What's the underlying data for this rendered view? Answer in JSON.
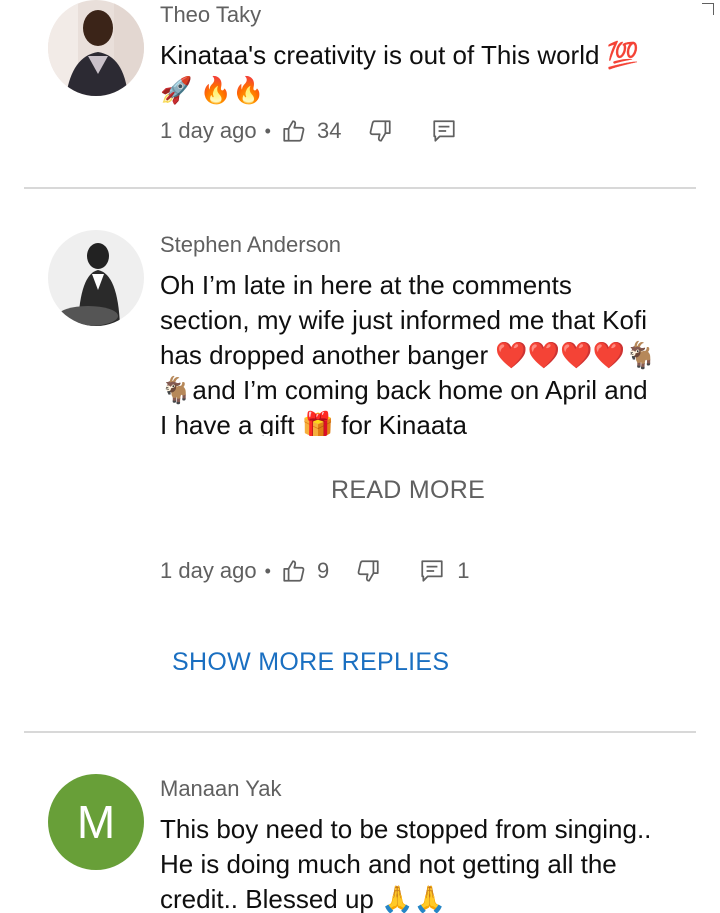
{
  "comments": [
    {
      "author": "Theo Taky",
      "text": "Kinataa's creativity is out of This world 💯🚀 🔥🔥",
      "time": "1 day ago",
      "likes": "34",
      "replies": ""
    },
    {
      "author": "Stephen Anderson",
      "text": "Oh I’m late in here at the comments section, my wife just informed me that Kofi has dropped another banger ❤️❤️❤️❤️🐐🐐and I’m coming back home on April and I have a gift 🎁 for Kinaata",
      "time": "1 day ago",
      "likes": "9",
      "replies": "1",
      "read_more_label": "READ MORE",
      "show_more_replies_label": "SHOW MORE REPLIES"
    },
    {
      "author": "Manaan Yak",
      "avatar_letter": "M",
      "avatar_color": "#689f38",
      "text": "This boy need to be stopped from singing.. He is doing much and not getting all the credit.. Blessed up 🙏🙏"
    }
  ],
  "meta_separator": "•",
  "colors": {
    "link_blue": "#1a6fc1",
    "secondary_text": "#606060",
    "divider": "#d8d8d8"
  }
}
